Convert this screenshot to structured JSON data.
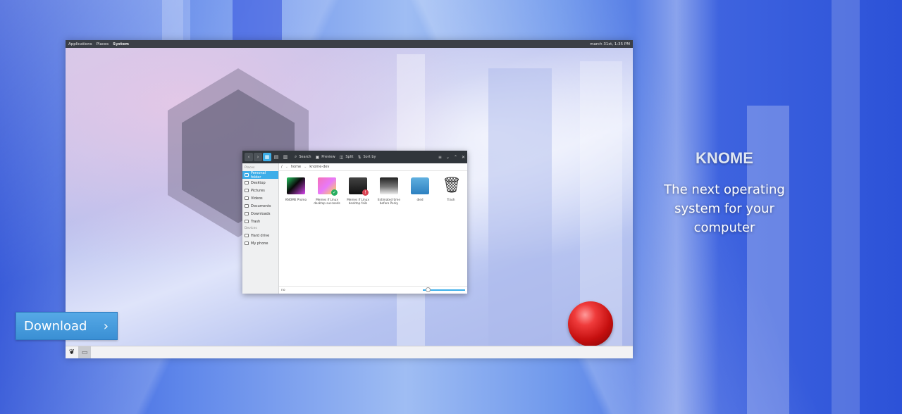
{
  "desktop": {
    "topbar": {
      "menu": [
        "Applications",
        "Places",
        "System"
      ],
      "clock": "march 31st, 1:35 PM"
    },
    "file_manager": {
      "toolbar": {
        "search": "Search",
        "preview": "Preview",
        "split": "Split",
        "sort_by": "Sort by"
      },
      "places": {
        "section_places": "Places",
        "items": [
          "Personal folder",
          "Desktop",
          "Pictures",
          "Videos",
          "Documents",
          "Downloads",
          "Trash"
        ],
        "section_devices": "Devices",
        "devices": [
          "Hard drive",
          "My phone"
        ]
      },
      "breadcrumb": [
        "/",
        "home",
        "knome-dev"
      ],
      "files": [
        {
          "name": "KNOME Promo"
        },
        {
          "name": "Memes if Linux desktop succeeds"
        },
        {
          "name": "Memes if Linux desktop fails"
        },
        {
          "name": "Estimated time before Porky"
        },
        {
          "name": "died"
        },
        {
          "name": "Trash"
        }
      ],
      "status": "no"
    }
  },
  "hero": {
    "brand": "KNOME",
    "tagline": "The next operating system for your computer"
  },
  "download": {
    "label": "Download",
    "chevron": "›"
  },
  "colors": {
    "accent": "#3daee9",
    "download_button": "#3a8fd4",
    "toolbar_dark": "#31363b"
  }
}
